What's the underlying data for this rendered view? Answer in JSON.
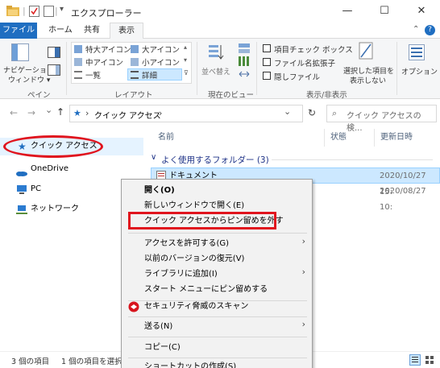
{
  "window": {
    "title": "エクスプローラー",
    "title_separator": "|",
    "minimize_glyph": "—",
    "maximize_glyph": "☐",
    "close_glyph": "✕"
  },
  "tabs": [
    "ファイル",
    "ホーム",
    "共有",
    "表示"
  ],
  "ribbon": {
    "nav_pane_label_1": "ナビゲーション",
    "nav_pane_label_2": "ウィンドウ ▾",
    "pane_group": "ペイン",
    "layout_items": [
      "特大アイコン",
      "大アイコン",
      "中アイコン",
      "小アイコン",
      "一覧",
      "詳細"
    ],
    "layout_group": "レイアウト",
    "sort_label": "並べ替え",
    "current_view_group": "現在のビュー",
    "checkboxes": [
      "項目チェック ボックス",
      "ファイル名拡張子",
      "隠しファイル"
    ],
    "hide_selected_1": "選択した項目を",
    "hide_selected_2": "表示しない",
    "show_hide_group": "表示/非表示",
    "options": "オプション"
  },
  "address": {
    "path": "クイック アクセス",
    "path_sep": "›",
    "dropdown_glyph": "⌄",
    "refresh_glyph": "↻",
    "search_placeholder": "クイック アクセスの検..."
  },
  "nav": {
    "back_glyph": "←",
    "forward_glyph": "→",
    "recent_glyph": "⌄",
    "up_glyph": "↑",
    "items": [
      "クイック アクセス",
      "OneDrive",
      "PC",
      "ネットワーク"
    ]
  },
  "list": {
    "columns": [
      "名前",
      "状態",
      "更新日時"
    ],
    "group_header": "よく使用するフォルダー (3)",
    "rows": [
      {
        "name": "ドキュメント",
        "date": "2020/10/27 15:"
      },
      {
        "name": "",
        "date": "2020/08/27 10:"
      }
    ]
  },
  "context_menu": {
    "items": [
      "開く(O)",
      "新しいウィンドウで開く(E)",
      "クイック アクセスからピン留めを外す",
      "アクセスを許可する(G)",
      "以前のバージョンの復元(V)",
      "ライブラリに追加(I)",
      "スタート メニューにピン留めする",
      "セキュリティ脅威のスキャン",
      "送る(N)",
      "コピー(C)",
      "ショートカットの作成(S)"
    ],
    "submenu_glyph": "›"
  },
  "status": {
    "count": "3 個の項目",
    "selected": "1 個の項目を選択"
  },
  "colors": {
    "file_tab": "#1f6ec1",
    "highlight_red": "#e0141e",
    "selection": "#cce8ff",
    "nav_hover": "#e5f3ff"
  }
}
